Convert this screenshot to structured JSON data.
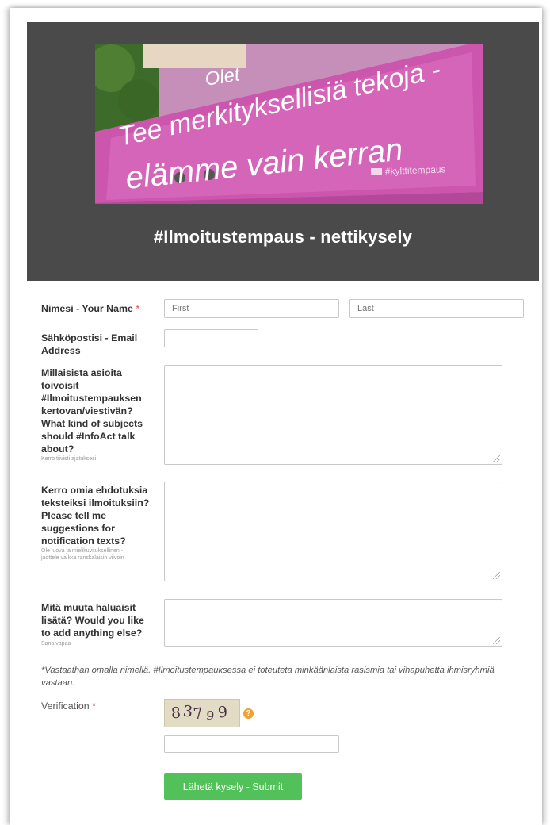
{
  "banner": {
    "sign_line1": "Olet",
    "sign_line2": "Tee merkityksellisiä tekoja -",
    "sign_line3": "elämme vain kerran",
    "sign_tag": "#kylttitempaus"
  },
  "form_title": "#Ilmoitustempaus - nettikysely",
  "name_field": {
    "label": "Nimesi - Your Name",
    "required_mark": "*",
    "first_placeholder": "First",
    "last_placeholder": "Last"
  },
  "email_field": {
    "label_line1": "Sähköpostisi - Email",
    "label_line2": "Address",
    "value": ""
  },
  "subjects_field": {
    "label_lines": [
      "Millaisista asioita",
      "toivoisit",
      "#Ilmoitustempauksen",
      "kertovan/viestivän?",
      "What kind of subjects",
      "should #InfoAct talk",
      "about?"
    ],
    "sublabel": "Kerro tiivisti ajatuksesi"
  },
  "suggestions_field": {
    "label_lines": [
      "Kerro omia ehdotuksia",
      "teksteiksi ilmoituksiin?",
      "Please tell me",
      "suggestions for",
      "notification texts?"
    ],
    "sublabel_lines": [
      "Ole luova ja mielikuvituksellinen -",
      "jaottele vaikka ranskalaisin viivoin"
    ]
  },
  "else_field": {
    "label_lines": [
      "Mitä muuta haluaisit",
      "lisätä? Would you like",
      "to add anything else?"
    ],
    "sublabel": "Sana vapaa"
  },
  "note": "*Vastaathan omalla nimellä. #Ilmoitustempauksessa ei toteuteta minkäänlaista rasismia tai vihapuhetta ihmisryhmiä vastaan.",
  "verification": {
    "label": "Verification",
    "required_mark": "*",
    "captcha_chars": [
      "8",
      "3",
      "7",
      "9",
      "9"
    ],
    "help_glyph": "?",
    "value": ""
  },
  "submit_label": "Lähetä kysely - Submit",
  "colors": {
    "header_bg": "#4a4a4a",
    "sign_pink": "#cf5bb2",
    "required": "#e1464c",
    "submit_green": "#52c15a",
    "help_orange": "#f0a12e"
  }
}
